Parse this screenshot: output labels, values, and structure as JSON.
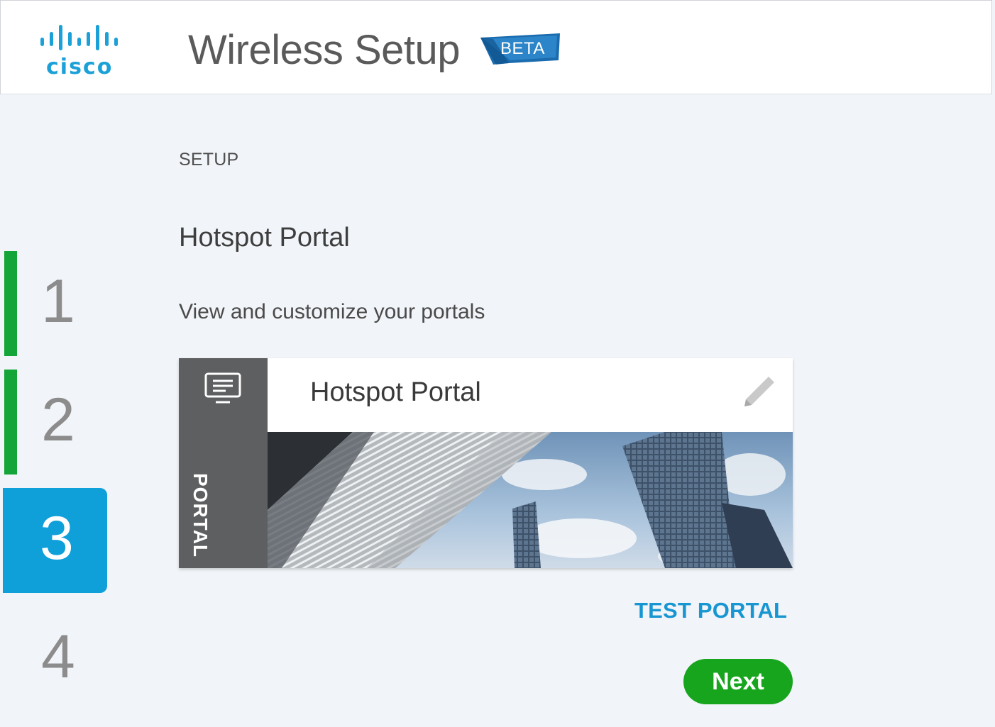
{
  "header": {
    "brand": "cisco",
    "title": "Wireless Setup",
    "badge": "BETA"
  },
  "steps": [
    {
      "number": "1",
      "state": "complete"
    },
    {
      "number": "2",
      "state": "complete"
    },
    {
      "number": "3",
      "state": "active"
    },
    {
      "number": "4",
      "state": "pending"
    }
  ],
  "main": {
    "section_label": "SETUP",
    "heading": "Hotspot Portal",
    "subheading": "View and customize your portals",
    "portal_card": {
      "side_label": "PORTAL",
      "title": "Hotspot Portal",
      "icon": "monitor-icon",
      "edit_icon": "pencil-icon"
    },
    "test_portal_label": "TEST PORTAL",
    "next_label": "Next"
  },
  "colors": {
    "accent_blue": "#0f9fd9",
    "complete_green": "#13a538",
    "next_green": "#16a51c",
    "link_blue": "#1896d2",
    "card_side_gray": "#5e5f61",
    "background": "#f1f4f8"
  }
}
